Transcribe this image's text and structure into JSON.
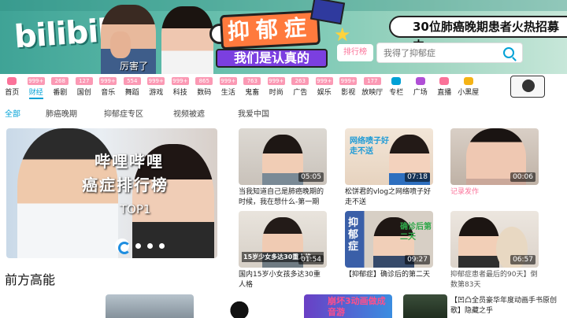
{
  "banner": {
    "logo": "bilibili",
    "caption": "厉害了",
    "campaign_line1": "抑郁症",
    "campaign_line2": "我们是认真的",
    "notice": "30位肺癌晚期患者火热招募中",
    "rank_label": "排行榜",
    "search_placeholder": "我得了抑郁症"
  },
  "categories": [
    {
      "label": "首页",
      "badge": "",
      "icon_color": "#fb7299"
    },
    {
      "label": "财经",
      "badge": "999+",
      "active": true
    },
    {
      "label": "番剧",
      "badge": "268"
    },
    {
      "label": "国创",
      "badge": "127"
    },
    {
      "label": "音乐",
      "badge": "999+"
    },
    {
      "label": "舞蹈",
      "badge": "554"
    },
    {
      "label": "游戏",
      "badge": "999+"
    },
    {
      "label": "科技",
      "badge": "999+"
    },
    {
      "label": "数码",
      "badge": "865"
    },
    {
      "label": "生活",
      "badge": "999+"
    },
    {
      "label": "鬼畜",
      "badge": "763"
    },
    {
      "label": "时尚",
      "badge": "999+"
    },
    {
      "label": "广告",
      "badge": "263"
    },
    {
      "label": "娱乐",
      "badge": "999+"
    },
    {
      "label": "影视",
      "badge": "999+"
    },
    {
      "label": "放映厅",
      "badge": "177"
    },
    {
      "label": "专栏",
      "badge": "",
      "icon_color": "#00a1d6"
    },
    {
      "label": "广场",
      "badge": "",
      "icon_color": "#b04fd6"
    },
    {
      "label": "直播",
      "badge": "",
      "icon_color": "#fb7299"
    },
    {
      "label": "小黑屋",
      "badge": "",
      "icon_color": "#f5b315"
    }
  ],
  "subtabs": [
    "全部",
    "肺癌晚期",
    "抑郁症专区",
    "视频被遮",
    "我爱中国"
  ],
  "carousel": {
    "line1": "哔哩哔哩",
    "line2": "癌症排行榜",
    "line3": "TOP1"
  },
  "videos": [
    {
      "duration": "05:05",
      "title": "当我知道自己是肺癌晚期的时候，我在想什么-第一期"
    },
    {
      "duration": "07:18",
      "title": "松饼君的vlog之网络喷子好走不送",
      "overlay": "网络喷子好走不送"
    },
    {
      "duration": "00:06",
      "title": "记录发作",
      "pink": true
    },
    {
      "duration": "01:54",
      "title": "国内15岁小女孩多达30重人格",
      "overlay": "15岁少女多达30重人格"
    },
    {
      "duration": "09:27",
      "title": "【抑郁症】确诊后的第二天",
      "overlay_left": "抑郁症",
      "overlay_right": "确诊后第二天"
    },
    {
      "duration": "06:57",
      "title": "抑郁症患者最后的90天】倒数第83天"
    }
  ],
  "section": {
    "title": "前方高能"
  },
  "bottom_items": [
    {
      "overlay": "崩坏3动画做成音游"
    },
    {
      "title": "【凹凸全员豪华年度动画手书原创歌】隐藏之乎"
    }
  ],
  "colors": {
    "accent": "#00a1d6",
    "pink": "#fb7299",
    "banner": "#5cb9a8"
  }
}
